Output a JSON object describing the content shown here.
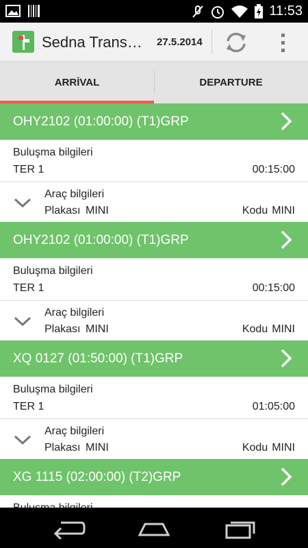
{
  "status_bar": {
    "time": "11:53",
    "icons": [
      "image-icon",
      "barcode-icon",
      "mute-icon",
      "alarm-icon",
      "wifi-icon",
      "battery-charging-icon"
    ]
  },
  "action_bar": {
    "title": "Sedna Trans…",
    "date": "27.5.2014",
    "icons": [
      "app-logo-icon",
      "refresh-icon",
      "overflow-menu-icon"
    ]
  },
  "tabs": [
    {
      "label": "ARRİVAL",
      "active": true
    },
    {
      "label": "DEPARTURE",
      "active": false
    }
  ],
  "colors": {
    "header_green": "#6fc36a",
    "tab_indicator": "#f05a4d",
    "action_bar_bg": "#f2f2f2",
    "tab_bg": "#e4e4e4"
  },
  "transfers": [
    {
      "flight": "OHY2102 (01:00:00) (T1)GRP",
      "meeting_label": "Buluşma bilgileri",
      "terminal": "TER 1",
      "time": "00:15:00",
      "vehicle_label": "Araç bilgileri",
      "plate_label": "Plakası",
      "plate_value": "MINI",
      "code_label": "Kodu",
      "code_value": "MINI"
    },
    {
      "flight": "OHY2102 (01:00:00) (T1)GRP",
      "meeting_label": "Buluşma bilgileri",
      "terminal": "TER 1",
      "time": "00:15:00",
      "vehicle_label": "Araç bilgileri",
      "plate_label": "Plakası",
      "plate_value": "MINI",
      "code_label": "Kodu",
      "code_value": "MINI"
    },
    {
      "flight": "XQ 0127 (01:50:00) (T1)GRP",
      "meeting_label": "Buluşma bilgileri",
      "terminal": "TER 1",
      "time": "01:05:00",
      "vehicle_label": "Araç bilgileri",
      "plate_label": "Plakası",
      "plate_value": "MINI",
      "code_label": "Kodu",
      "code_value": "MINI"
    },
    {
      "flight": "XG 1115 (02:00:00) (T2)GRP",
      "meeting_label": "Buluşma bilgileri"
    }
  ],
  "nav_bar": {
    "icons": [
      "back-icon",
      "home-icon",
      "recent-apps-icon"
    ]
  }
}
